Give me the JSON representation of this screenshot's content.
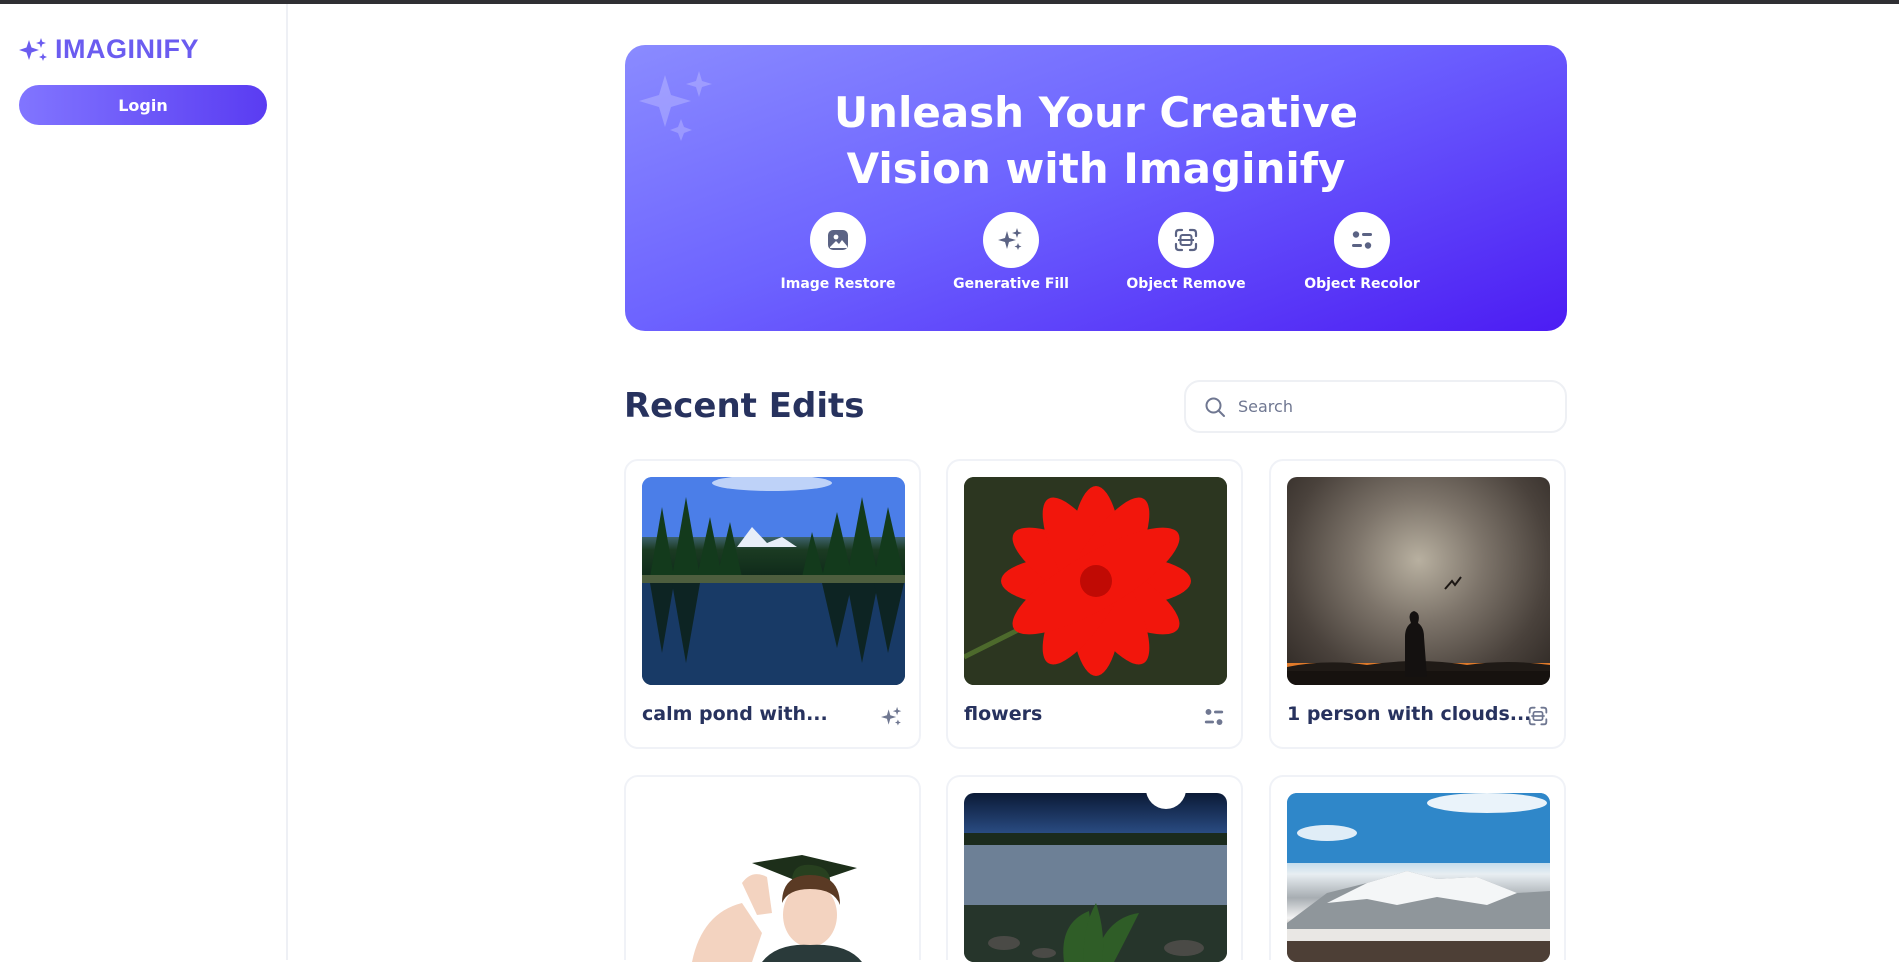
{
  "app": {
    "name": "IMAGINIFY",
    "brand_color": "#6b5cf0"
  },
  "sidebar": {
    "login_label": "Login"
  },
  "hero": {
    "title_line1": "Unleash Your Creative",
    "title_line2": "Vision with Imaginify",
    "tools": [
      {
        "label": "Image Restore",
        "icon": "image-icon"
      },
      {
        "label": "Generative Fill",
        "icon": "stars-icon"
      },
      {
        "label": "Object Remove",
        "icon": "scan-icon"
      },
      {
        "label": "Object Recolor",
        "icon": "filter-icon"
      }
    ]
  },
  "recent": {
    "title": "Recent Edits",
    "search_placeholder": "Search",
    "cards": [
      {
        "title": "calm pond with...",
        "icon": "stars-icon"
      },
      {
        "title": "flowers",
        "icon": "filter-icon"
      },
      {
        "title": "1 person with clouds...",
        "icon": "scan-icon"
      },
      {
        "title": "",
        "icon": ""
      },
      {
        "title": "",
        "icon": ""
      },
      {
        "title": "",
        "icon": ""
      }
    ]
  }
}
